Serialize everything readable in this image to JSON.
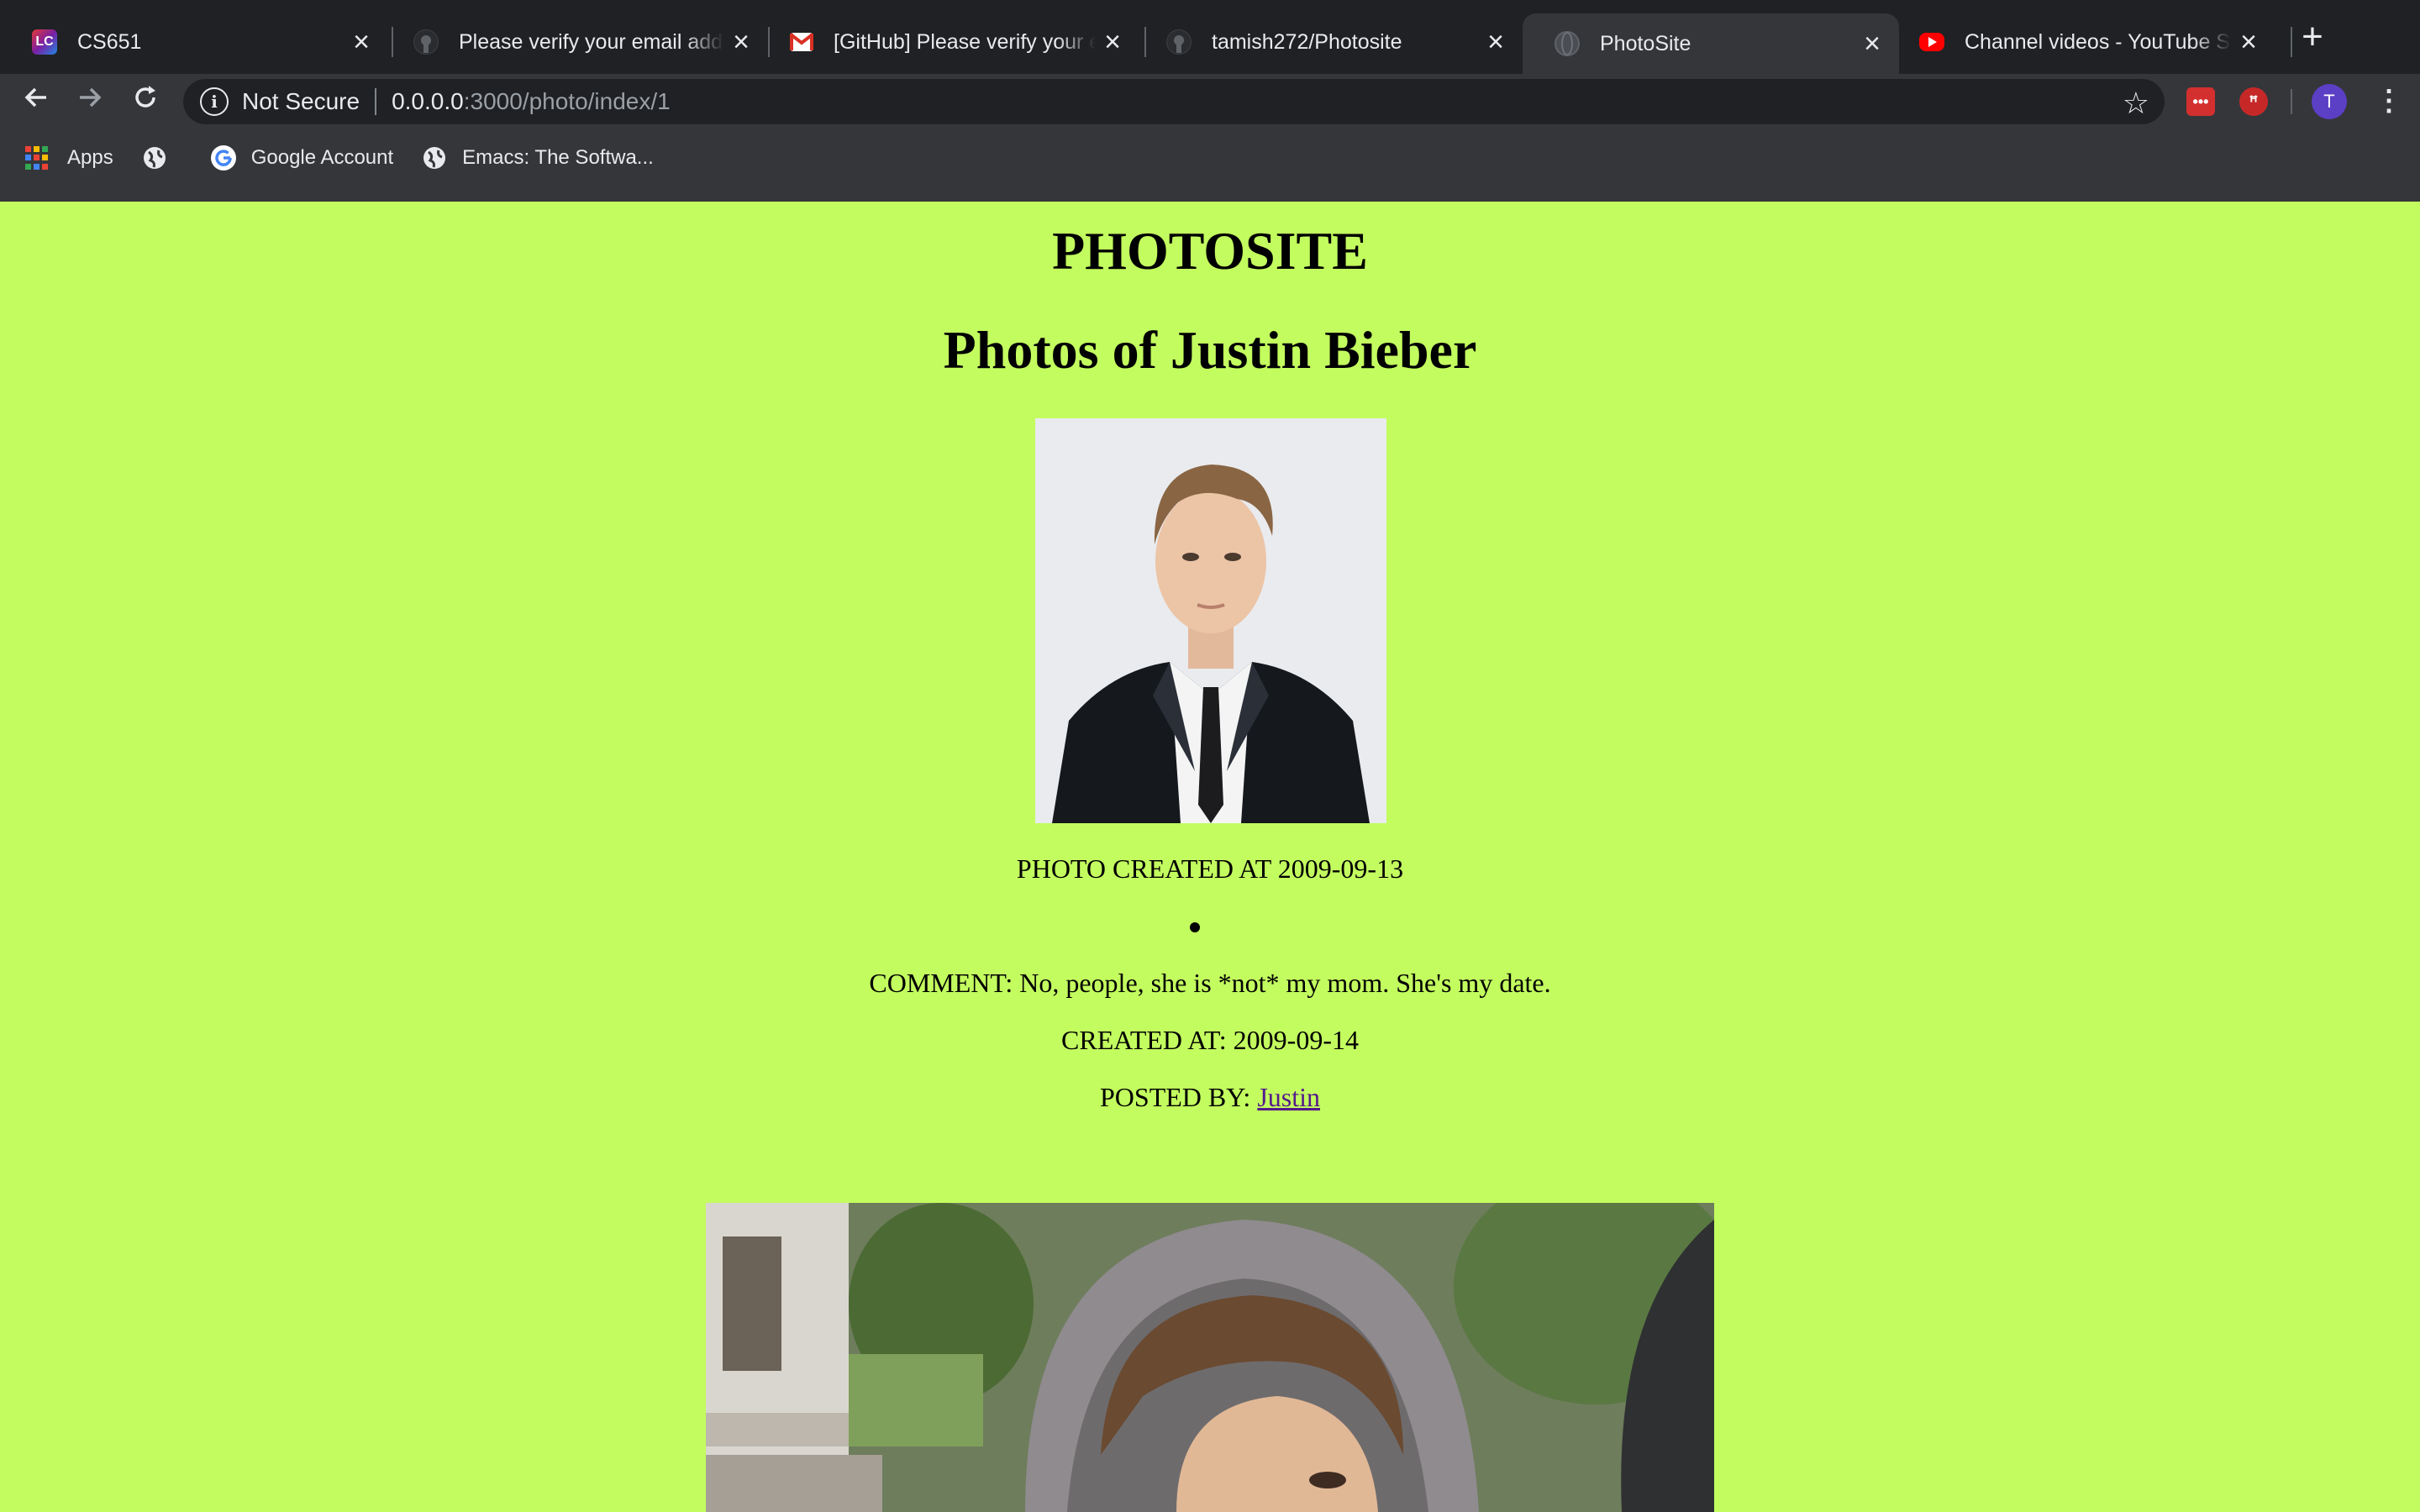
{
  "tabs": [
    {
      "title": "CS651",
      "icon": "lc-logo-icon",
      "active": false
    },
    {
      "title": "Please verify your email address",
      "icon": "github-icon",
      "active": false
    },
    {
      "title": "[GitHub] Please verify your email",
      "icon": "gmail-icon",
      "active": false
    },
    {
      "title": "tamish272/Photosite",
      "icon": "github-icon",
      "active": false
    },
    {
      "title": "PhotoSite",
      "icon": "globe-icon",
      "active": true
    },
    {
      "title": "Channel videos - YouTube Studio",
      "icon": "youtube-icon",
      "active": false
    }
  ],
  "toolbar": {
    "security_label": "Not Secure",
    "url_host": "0.0.0.0",
    "url_path": ":3000/photo/index/1",
    "avatar_initial": "T"
  },
  "bookmarks": [
    {
      "label": "Apps",
      "icon": "apps-grid-icon"
    },
    {
      "label": "",
      "icon": "globe-icon"
    },
    {
      "label": "Google Account",
      "icon": "google-icon"
    },
    {
      "label": "Emacs: The Softwa...",
      "icon": "globe-icon"
    }
  ],
  "page": {
    "site_title": "PHOTOSITE",
    "heading": "Photos of Justin Bieber",
    "photos": [
      {
        "created_text": "PHOTO CREATED AT 2009-09-13",
        "comments": [
          {
            "comment_text": "COMMENT: No, people, she is *not* my mom. She's my date.",
            "created_text": "CREATED AT: 2009-09-14",
            "posted_by_label": "POSTED BY:",
            "posted_by_user": "Justin"
          }
        ]
      }
    ]
  },
  "colors": {
    "page_background": "#c3fc5f",
    "chrome_dark": "#202124",
    "chrome_toolbar": "#35363a",
    "link_visited": "#551a8b",
    "avatar": "#5b3fc4"
  }
}
